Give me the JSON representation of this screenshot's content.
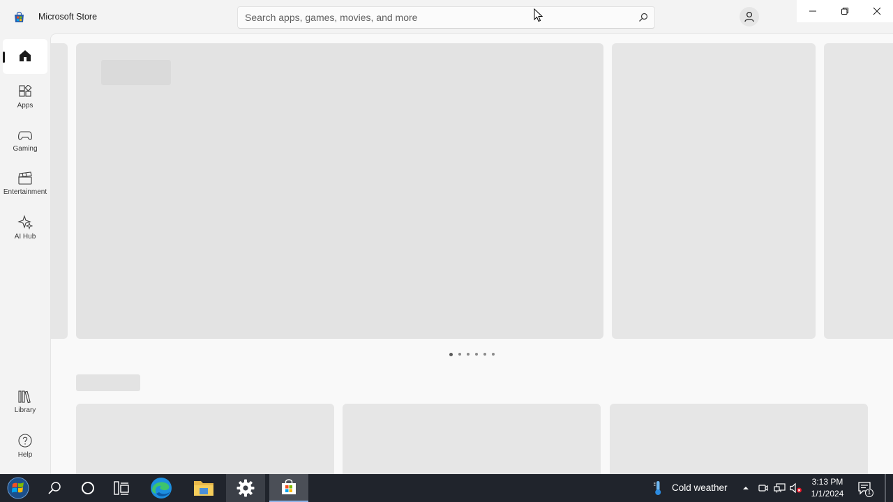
{
  "window": {
    "title": "Microsoft Store",
    "icons": {
      "logo": "store-logo-icon",
      "minimize": "minimize-icon",
      "restore": "restore-icon",
      "close": "close-icon"
    }
  },
  "search": {
    "placeholder": "Search apps, games, movies, and more",
    "value": "",
    "icon": "search-icon"
  },
  "account": {
    "icon": "person-icon"
  },
  "sidebar": {
    "items": [
      {
        "label": "Home",
        "icon": "home-icon",
        "selected": true
      },
      {
        "label": "Apps",
        "icon": "apps-icon"
      },
      {
        "label": "Gaming",
        "icon": "gamepad-icon"
      },
      {
        "label": "Entertainment",
        "icon": "clapperboard-icon"
      },
      {
        "label": "AI Hub",
        "icon": "sparkle-icon"
      }
    ],
    "bottom_items": [
      {
        "label": "Library",
        "icon": "library-icon"
      },
      {
        "label": "Help",
        "icon": "help-icon"
      }
    ]
  },
  "carousel": {
    "page_count": 6,
    "active_index": 0,
    "state": "loading"
  },
  "taskbar": {
    "apps": [
      {
        "name": "Start",
        "icon": "start-orb-icon"
      },
      {
        "name": "Search",
        "icon": "search-icon"
      },
      {
        "name": "Cortana",
        "icon": "cortana-circle-icon"
      },
      {
        "name": "Task View",
        "icon": "task-view-icon"
      },
      {
        "name": "Microsoft Edge",
        "icon": "edge-icon"
      },
      {
        "name": "File Explorer",
        "icon": "folder-icon"
      },
      {
        "name": "Settings",
        "icon": "settings-gear-icon"
      },
      {
        "name": "Microsoft Store",
        "icon": "store-icon"
      }
    ],
    "weather": {
      "text": "Cold weather",
      "icon": "thermometer-icon"
    },
    "tray_icons": [
      "chevron-up-icon",
      "meet-now-icon",
      "network-icon",
      "volume-muted-icon"
    ],
    "clock": {
      "time": "3:13 PM",
      "date": "1/1/2024"
    },
    "notifications": {
      "count": "1",
      "icon": "notification-icon"
    }
  },
  "colors": {
    "background": "#f3f3f3",
    "content": "#f9f9f9",
    "placeholder": "#e6e6e6",
    "taskbar": "#20242c"
  }
}
